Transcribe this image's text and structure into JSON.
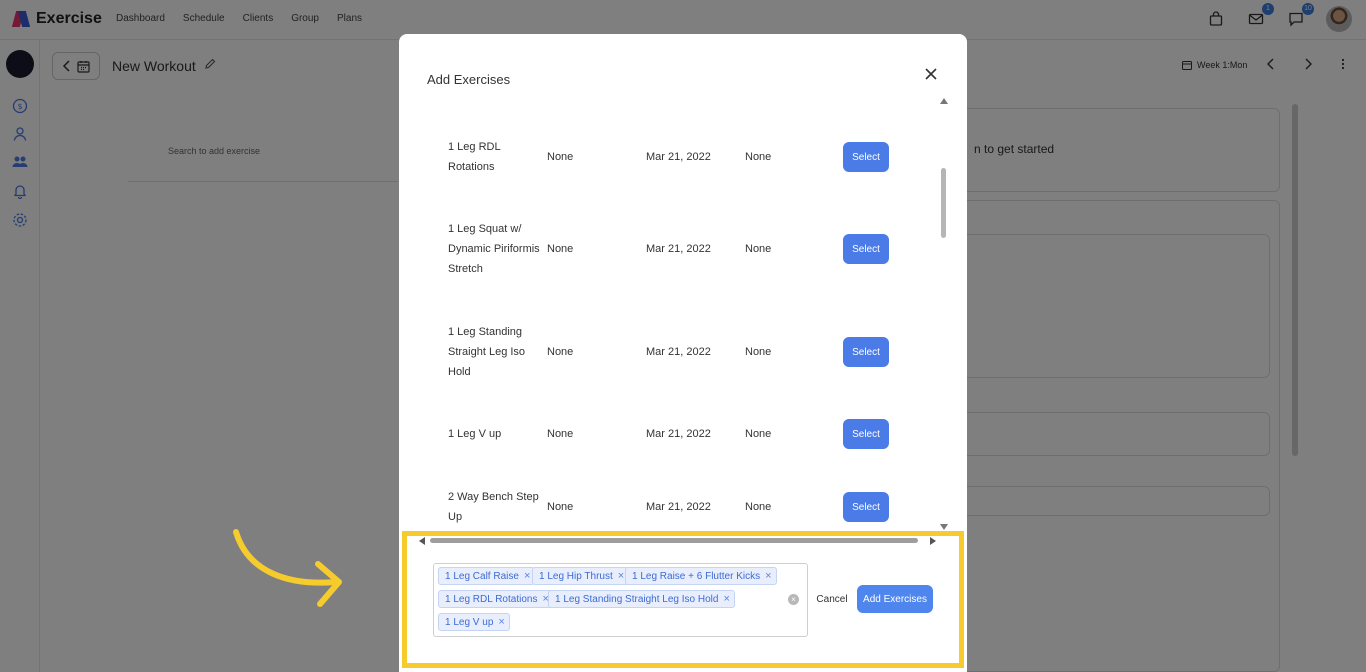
{
  "app": {
    "name": "Exercise",
    "nav": [
      "Dashboard",
      "Schedule",
      "Clients",
      "Group",
      "Plans"
    ],
    "badges": {
      "mail": "1",
      "chat": "10"
    }
  },
  "workout": {
    "title": "New Workout",
    "week_label": "Week 1:Mon",
    "search_placeholder": "Search to add exercise",
    "get_started": "n to get started"
  },
  "modal": {
    "title": "Add Exercises",
    "rows": [
      {
        "name": "1 Leg RDL Rotations",
        "col2": "None",
        "date": "Mar 21, 2022",
        "col4": "None",
        "action": "Select"
      },
      {
        "name": "1 Leg Squat w/ Dynamic Piriformis Stretch",
        "col2": "None",
        "date": "Mar 21, 2022",
        "col4": "None",
        "action": "Select"
      },
      {
        "name": "1 Leg Standing Straight Leg Iso Hold",
        "col2": "None",
        "date": "Mar 21, 2022",
        "col4": "None",
        "action": "Select"
      },
      {
        "name": "1 Leg V up",
        "col2": "None",
        "date": "Mar 21, 2022",
        "col4": "None",
        "action": "Select"
      },
      {
        "name": "2 Way Bench Step Up",
        "col2": "None",
        "date": "Mar 21, 2022",
        "col4": "None",
        "action": "Select"
      }
    ],
    "selected_tags": [
      "1 Leg Calf Raise",
      "1 Leg Hip Thrust",
      "1 Leg Raise + 6 Flutter Kicks",
      "1 Leg RDL Rotations",
      "1 Leg Standing Straight Leg Iso Hold",
      "1 Leg V up"
    ],
    "cancel_label": "Cancel",
    "submit_label": "Add Exercises"
  },
  "colors": {
    "accent": "#4a7be6",
    "highlight": "#f5cb2e",
    "tag_bg": "#e8eefc",
    "tag_text": "#3d6bd6"
  }
}
